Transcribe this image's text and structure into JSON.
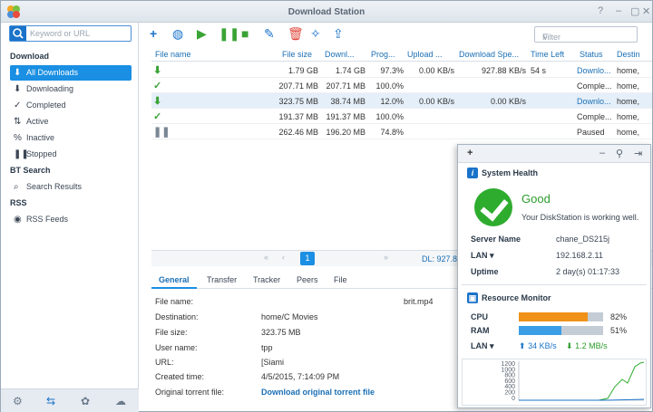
{
  "window": {
    "title": "Download Station"
  },
  "sidebar": {
    "search_placeholder": "Keyword or URL",
    "download_header": "Download",
    "items": [
      {
        "label": "All Downloads",
        "icon": "download-icon"
      },
      {
        "label": "Downloading",
        "icon": "download-icon"
      },
      {
        "label": "Completed",
        "icon": "check-icon"
      },
      {
        "label": "Active",
        "icon": "arrows-icon"
      },
      {
        "label": "Inactive",
        "icon": "percent-icon"
      },
      {
        "label": "Stopped",
        "icon": "pause-icon"
      }
    ],
    "bt_header": "BT Search",
    "bt_items": [
      {
        "label": "Search Results"
      }
    ],
    "rss_header": "RSS",
    "rss_items": [
      {
        "label": "RSS Feeds"
      }
    ]
  },
  "toolbar": {
    "filter_placeholder": "Filter"
  },
  "table": {
    "columns": [
      "File name",
      "File size",
      "Downl...",
      "Prog...",
      "Upload ...",
      "Download Spe...",
      "Time Left",
      "Status",
      "Destin"
    ],
    "rows": [
      {
        "icon": "down-arrow",
        "size": "1.79 GB",
        "downloaded": "1.74 GB",
        "progress": "97.3%",
        "upload": "0.00 KB/s",
        "download": "927.88 KB/s",
        "time_left": "54 s",
        "status": "Downlo...",
        "dest": "home,"
      },
      {
        "icon": "check",
        "size": "207.71 MB",
        "downloaded": "207.71 MB",
        "progress": "100.0%",
        "upload": "",
        "download": "",
        "time_left": "",
        "status": "Comple...",
        "dest": "home,"
      },
      {
        "icon": "down-arrow",
        "size": "323.75 MB",
        "downloaded": "38.74 MB",
        "progress": "12.0%",
        "upload": "0.00 KB/s",
        "download": "0.00 KB/s",
        "time_left": "",
        "status": "Downlo...",
        "dest": "home,"
      },
      {
        "icon": "check",
        "size": "191.37 MB",
        "downloaded": "191.37 MB",
        "progress": "100.0%",
        "upload": "",
        "download": "",
        "time_left": "",
        "status": "Comple...",
        "dest": "home,"
      },
      {
        "icon": "pause",
        "size": "262.46 MB",
        "downloaded": "196.20 MB",
        "progress": "74.8%",
        "upload": "",
        "download": "",
        "time_left": "",
        "status": "Paused",
        "dest": "home,"
      }
    ]
  },
  "pager": {
    "page": "1",
    "dl_status": "DL: 927.8"
  },
  "tabs": [
    "General",
    "Transfer",
    "Tracker",
    "Peers",
    "File"
  ],
  "details": {
    "file_name_label": "File name:",
    "file_name": "brit.mp4",
    "destination_label": "Destination:",
    "destination": "home/C Movies",
    "file_size_label": "File size:",
    "file_size": "323.75 MB",
    "user_label": "User name:",
    "user": "tpp",
    "url_label": "URL:",
    "url": "[Siami",
    "created_label": "Created time:",
    "created": "4/5/2015, 7:14:09 PM",
    "torrent_label": "Original torrent file:",
    "torrent_link": "Download original torrent file"
  },
  "health": {
    "title": "System Health",
    "status": "Good",
    "message": "Your DiskStation is working well.",
    "server_label": "Server Name",
    "server": "chane_DS215j",
    "lan_label": "LAN",
    "lan": "192.168.2.11",
    "uptime_label": "Uptime",
    "uptime": "2 day(s) 01:17:33"
  },
  "resource": {
    "title": "Resource Monitor",
    "cpu_label": "CPU",
    "cpu_pct": "82%",
    "cpu_value": 0.82,
    "ram_label": "RAM",
    "ram_pct": "51%",
    "ram_value": 0.51,
    "lan_label": "LAN",
    "up": "34 KB/s",
    "down": "1.2 MB/s",
    "y_ticks": [
      "1200",
      "1000",
      "800",
      "600",
      "400",
      "200",
      "0"
    ]
  },
  "colors": {
    "accent": "#1a8fe3",
    "good": "#2eac2e",
    "cpu": "#f0921a",
    "ram": "#3a9de6"
  }
}
